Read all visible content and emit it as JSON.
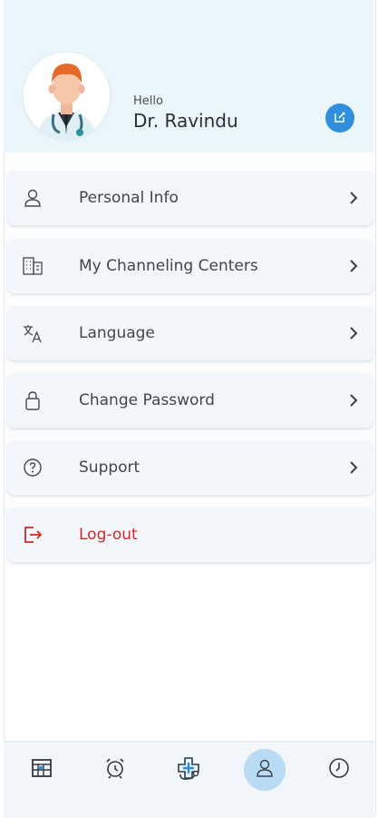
{
  "profile": {
    "greeting": "Hello",
    "name": "Dr. Ravindu",
    "avatar_icon": "doctor-avatar-icon",
    "edit_icon": "edit-icon"
  },
  "menu": [
    {
      "label": "Personal Info",
      "icon": "person-icon",
      "has_chevron": true
    },
    {
      "label": "My Channeling Centers",
      "icon": "buildings-icon",
      "has_chevron": true
    },
    {
      "label": "Language",
      "icon": "translate-icon",
      "has_chevron": true
    },
    {
      "label": "Change Password",
      "icon": "lock-icon",
      "has_chevron": true
    },
    {
      "label": "Support",
      "icon": "help-circle-icon",
      "has_chevron": true
    },
    {
      "label": "Log-out",
      "icon": "logout-icon",
      "has_chevron": false
    }
  ],
  "bottom_nav": [
    {
      "icon": "calendar-grid-icon",
      "active": false
    },
    {
      "icon": "alarm-clock-icon",
      "active": false
    },
    {
      "icon": "medical-stethoscope-icon",
      "active": false
    },
    {
      "icon": "profile-icon",
      "active": true
    },
    {
      "icon": "history-clock-icon",
      "active": false
    }
  ],
  "colors": {
    "header_bg": "#eaf6fb",
    "accent": "#2f8fdc",
    "logout": "#d42727",
    "active_nav": "#b9dcf4"
  }
}
